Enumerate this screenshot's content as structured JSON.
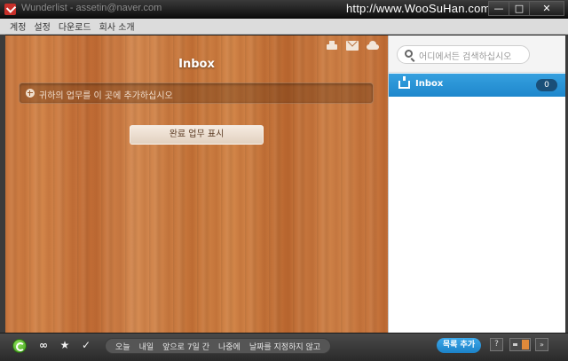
{
  "window": {
    "title": "Wunderlist - assetin@naver.com",
    "watermark": "http://www.WooSuHan.com",
    "buttons": {
      "minimize": "—",
      "maximize": "□",
      "close": "✕"
    }
  },
  "menu": {
    "items": [
      {
        "label": "계정"
      },
      {
        "label": "설정"
      },
      {
        "label": "다운로드"
      },
      {
        "label": "회사 소개"
      }
    ]
  },
  "main": {
    "list_title": "Inbox",
    "task_placeholder": "귀하의 업무를 이 곳에 추가하십시오",
    "show_done_label": "완료 업무 표시",
    "tool_icons": [
      "print-icon",
      "mail-icon",
      "cloud-icon"
    ]
  },
  "sidebar": {
    "search_placeholder": "어디에서든 검색하십시오",
    "lists": [
      {
        "label": "Inbox",
        "count": "0"
      }
    ]
  },
  "bottombar": {
    "filter_icons": {
      "all": "∞",
      "starred": "★",
      "done": "✓"
    },
    "date_filters": [
      {
        "label": "오늘"
      },
      {
        "label": "내일"
      },
      {
        "label": "앞으로 7일 간"
      },
      {
        "label": "나중에"
      },
      {
        "label": "날짜를 지정하지 않고"
      }
    ],
    "add_list_label": "목록 추가",
    "help_label": "?",
    "expand_label": "»"
  },
  "colors": {
    "accent_blue": "#1e87cc",
    "sync_green": "#3e9d1b"
  }
}
